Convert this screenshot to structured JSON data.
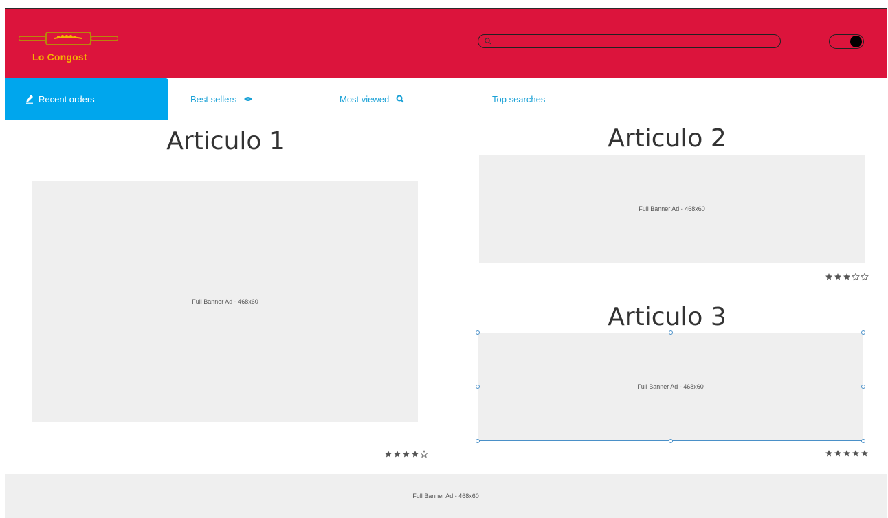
{
  "header": {
    "brand": "Lo Congost",
    "search": {
      "value": "",
      "placeholder": ""
    },
    "icons": {
      "logo": "rolling-pin-wheat-logo",
      "search": "search-icon",
      "toggle": "toggle-switch"
    },
    "colors": {
      "header_bg": "#dc143c",
      "logo_gold": "#f4b400"
    }
  },
  "tabs": [
    {
      "label": "Recent orders",
      "icon": "pen-icon",
      "active": true
    },
    {
      "label": "Best sellers",
      "icon": "eye-icon",
      "active": false
    },
    {
      "label": "Most viewed",
      "icon": "search-icon",
      "active": false
    },
    {
      "label": "Top searches",
      "icon": "",
      "active": false
    }
  ],
  "articles": [
    {
      "title": "Articulo 1",
      "ad_label": "Full Banner Ad - 468x60",
      "rating": 4,
      "max_rating": 5
    },
    {
      "title": "Articulo 2",
      "ad_label": "Full Banner Ad - 468x60",
      "rating": 3,
      "max_rating": 5
    },
    {
      "title": "Articulo 3",
      "ad_label": "Full Banner Ad - 468x60",
      "rating": 5,
      "max_rating": 5
    }
  ],
  "footer": {
    "ad_label": "Full Banner Ad - 468x60"
  },
  "colors": {
    "accent": "#00a6ed",
    "tab_text": "#1aa1d6",
    "ad_bg": "#efefef",
    "selection": "#4a90c8"
  }
}
